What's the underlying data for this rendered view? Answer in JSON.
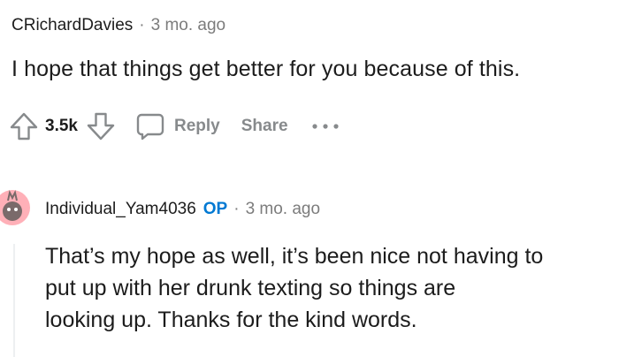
{
  "comments": [
    {
      "username": "CRichardDavies",
      "separator": "·",
      "time": "3 mo. ago",
      "body": "I hope that things get better for you because of this.",
      "actions": {
        "score": "3.5k",
        "reply_label": "Reply",
        "share_label": "Share",
        "more_label": "•••"
      }
    },
    {
      "username": "Individual_Yam4036",
      "op_badge": "OP",
      "separator": "·",
      "time": "3 mo. ago",
      "body_lines": [
        "That’s my hope as well, it’s been nice not having to",
        "put up with her drunk texting so things are",
        "looking up. Thanks for the kind words."
      ]
    }
  ],
  "colors": {
    "text": "#1c1c1c",
    "meta": "#7c7c7c",
    "action": "#878a8c",
    "op": "#0079d3",
    "avatar_bg": "#ffb0b8"
  },
  "icons": [
    "upvote-icon",
    "downvote-icon",
    "comment-bubble-icon",
    "more-options-icon",
    "avatar-icon"
  ]
}
